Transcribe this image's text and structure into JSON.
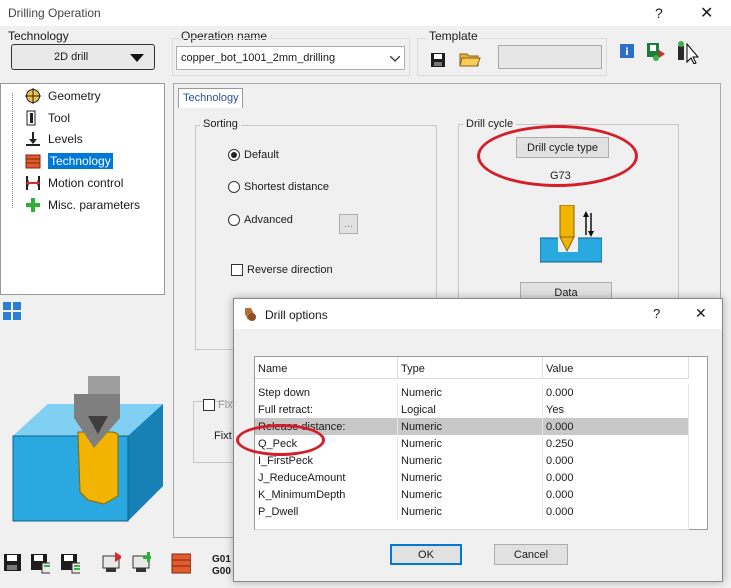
{
  "window": {
    "title": "Drilling Operation",
    "help": "?",
    "close": "✕"
  },
  "technology": {
    "label": "Technology",
    "value": "2D drill"
  },
  "operation": {
    "label": "Operation name",
    "value": "copper_bot_1001_2mm_drilling"
  },
  "template": {
    "label": "Template"
  },
  "tree": {
    "items": [
      {
        "label": "Geometry",
        "icon": "target-icon"
      },
      {
        "label": "Tool",
        "icon": "tool-icon"
      },
      {
        "label": "Levels",
        "icon": "levels-icon"
      },
      {
        "label": "Technology",
        "icon": "technology-icon",
        "selected": true
      },
      {
        "label": "Motion control",
        "icon": "motion-icon"
      },
      {
        "label": "Misc. parameters",
        "icon": "plus-icon"
      }
    ]
  },
  "tab": {
    "label": "Technology"
  },
  "sorting": {
    "label": "Sorting",
    "options": [
      {
        "label": "Default",
        "checked": true
      },
      {
        "label": "Shortest distance",
        "checked": false
      },
      {
        "label": "Advanced",
        "checked": false
      }
    ],
    "advanced_button": "...",
    "reverse": "Reverse direction"
  },
  "drill_cycle": {
    "label": "Drill cycle",
    "button": "Drill cycle type",
    "value": "G73",
    "data_button": "Data"
  },
  "partial": {
    "fix_check": "Fix",
    "fix_label": "Fixt"
  },
  "footer": {
    "gcode_top": "G01",
    "gcode_bottom": "G00"
  },
  "drill_options": {
    "title": "Drill options",
    "help": "?",
    "close": "✕",
    "columns": [
      "Name",
      "Type",
      "Value"
    ],
    "rows": [
      {
        "name": "Step down",
        "type": "Numeric",
        "value": "0.000"
      },
      {
        "name": "Full retract:",
        "type": "Logical",
        "value": "Yes"
      },
      {
        "name": "Release distance:",
        "type": "Numeric",
        "value": "0.000"
      },
      {
        "name": "Q_Peck",
        "type": "Numeric",
        "value": "0.250"
      },
      {
        "name": "I_FirstPeck",
        "type": "Numeric",
        "value": "0.000"
      },
      {
        "name": "J_ReduceAmount",
        "type": "Numeric",
        "value": "0.000"
      },
      {
        "name": "K_MinimumDepth",
        "type": "Numeric",
        "value": "0.000"
      },
      {
        "name": "P_Dwell",
        "type": "Numeric",
        "value": "0.000"
      }
    ],
    "ok": "OK",
    "cancel": "Cancel"
  },
  "colors": {
    "selection": "#0078d7",
    "annotation": "#d41e2a",
    "part": "#2aa8e0",
    "tool": "#f2b400"
  }
}
